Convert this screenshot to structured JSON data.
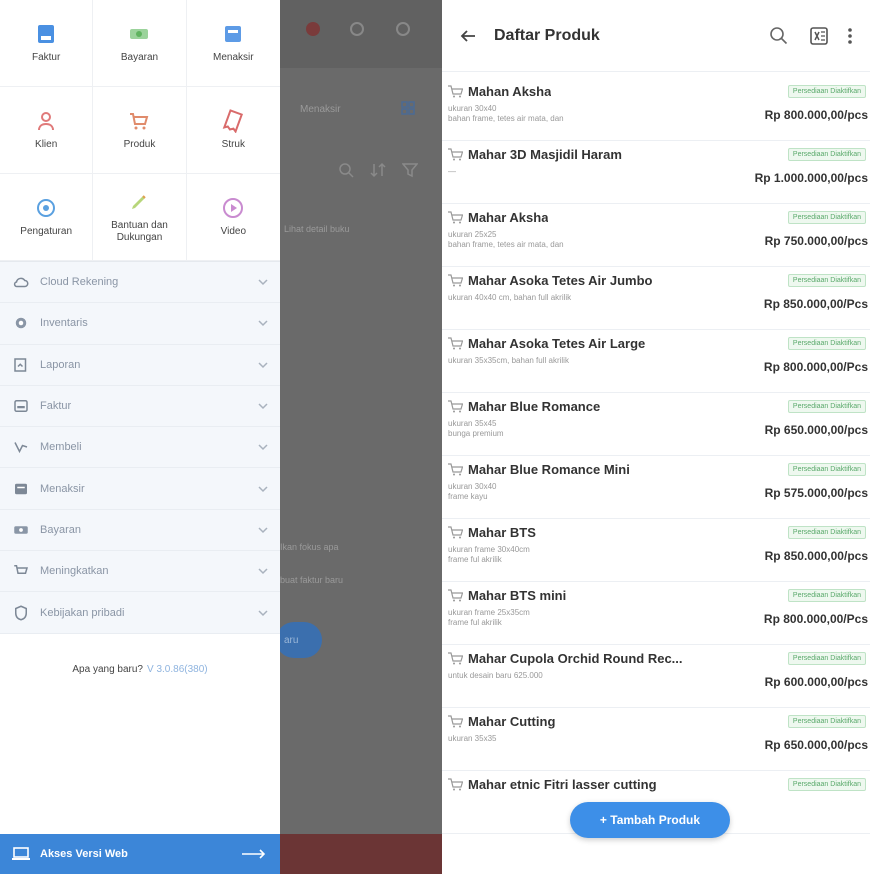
{
  "drawer": {
    "grid": [
      {
        "label": "Faktur",
        "icon": "invoice-icon"
      },
      {
        "label": "Bayaran",
        "icon": "money-icon"
      },
      {
        "label": "Menaksir",
        "icon": "estimate-icon"
      },
      {
        "label": "Klien",
        "icon": "person-icon"
      },
      {
        "label": "Produk",
        "icon": "cart-icon"
      },
      {
        "label": "Struk",
        "icon": "receipt-icon"
      },
      {
        "label": "Pengaturan",
        "icon": "settings-icon"
      },
      {
        "label": "Bantuan dan Dukungan",
        "icon": "help-pencil-icon"
      },
      {
        "label": "Video",
        "icon": "play-icon"
      }
    ],
    "menu": [
      {
        "label": "Cloud Rekening",
        "icon": "cloud-icon"
      },
      {
        "label": "Inventaris",
        "icon": "inventory-icon"
      },
      {
        "label": "Laporan",
        "icon": "report-icon"
      },
      {
        "label": "Faktur",
        "icon": "invoice-icon"
      },
      {
        "label": "Membeli",
        "icon": "buy-icon"
      },
      {
        "label": "Menaksir",
        "icon": "estimate-icon"
      },
      {
        "label": "Bayaran",
        "icon": "money-icon"
      },
      {
        "label": "Meningkatkan",
        "icon": "upgrade-cart-icon"
      },
      {
        "label": "Kebijakan pribadi",
        "icon": "shield-icon"
      }
    ],
    "version_label": "Apa yang baru?",
    "version_value": "V 3.0.86(380)",
    "web_access": "Akses Versi Web"
  },
  "background": {
    "tab": "Menaksir",
    "hint": "Lihat detail buku",
    "text_a": "Ikan fokus apa",
    "text_b": "buat faktur baru",
    "button": "aru"
  },
  "products_page": {
    "title": "Daftar Produk",
    "fab_label": "+ Tambah Produk",
    "items": [
      {
        "name": "Mahan Aksha",
        "desc": [
          "ukuran 30x40",
          "bahan frame, tetes air mata, dan"
        ],
        "badge": "Persediaan Diaktifkan",
        "price": "Rp 800.000,00/pcs"
      },
      {
        "name": "Mahar 3D Masjidil Haram",
        "desc": [
          "—"
        ],
        "badge": "Persediaan Diaktifkan",
        "price": "Rp 1.000.000,00/pcs"
      },
      {
        "name": "Mahar Aksha",
        "desc": [
          "ukuran 25x25",
          "bahan frame, tetes air mata, dan"
        ],
        "badge": "Persediaan Diaktifkan",
        "price": "Rp 750.000,00/pcs"
      },
      {
        "name": "Mahar Asoka Tetes Air Jumbo",
        "desc": [
          "ukuran 40x40 cm, bahan full akrilik"
        ],
        "badge": "Persediaan Diaktifkan",
        "price": "Rp 850.000,00/Pcs"
      },
      {
        "name": "Mahar Asoka Tetes Air Large",
        "desc": [
          "ukuran 35x35cm, bahan full akrilik"
        ],
        "badge": "Persediaan Diaktifkan",
        "price": "Rp 800.000,00/Pcs"
      },
      {
        "name": "Mahar Blue Romance",
        "desc": [
          "ukuran 35x45",
          "bunga premium"
        ],
        "badge": "Persediaan Diaktifkan",
        "price": "Rp 650.000,00/pcs"
      },
      {
        "name": "Mahar Blue Romance Mini",
        "desc": [
          "ukuran 30x40",
          "frame kayu"
        ],
        "badge": "Persediaan Diaktifkan",
        "price": "Rp 575.000,00/pcs"
      },
      {
        "name": "Mahar BTS",
        "desc": [
          "ukuran frame 30x40cm",
          "frame ful akrilik"
        ],
        "badge": "Persediaan Diaktifkan",
        "price": "Rp 850.000,00/pcs"
      },
      {
        "name": "Mahar BTS mini",
        "desc": [
          "ukuran frame 25x35cm",
          "frame ful akrilik"
        ],
        "badge": "Persediaan Diaktifkan",
        "price": "Rp 800.000,00/Pcs"
      },
      {
        "name": "Mahar Cupola Orchid Round Rec...",
        "desc": [
          "untuk desain baru 625.000"
        ],
        "badge": "Persediaan Diaktifkan",
        "price": "Rp 600.000,00/pcs"
      },
      {
        "name": "Mahar Cutting",
        "desc": [
          "ukuran 35x35"
        ],
        "badge": "Persediaan Diaktifkan",
        "price": "Rp 650.000,00/pcs"
      },
      {
        "name": "Mahar etnic Fitri lasser cutting",
        "desc": [
          ""
        ],
        "badge": "Persediaan Diaktifkan",
        "price": ""
      }
    ]
  },
  "colors": {
    "primary": "#3d8fe8",
    "badge_green": "#5aa96b",
    "drawer_bg": "#f4f7fb"
  }
}
